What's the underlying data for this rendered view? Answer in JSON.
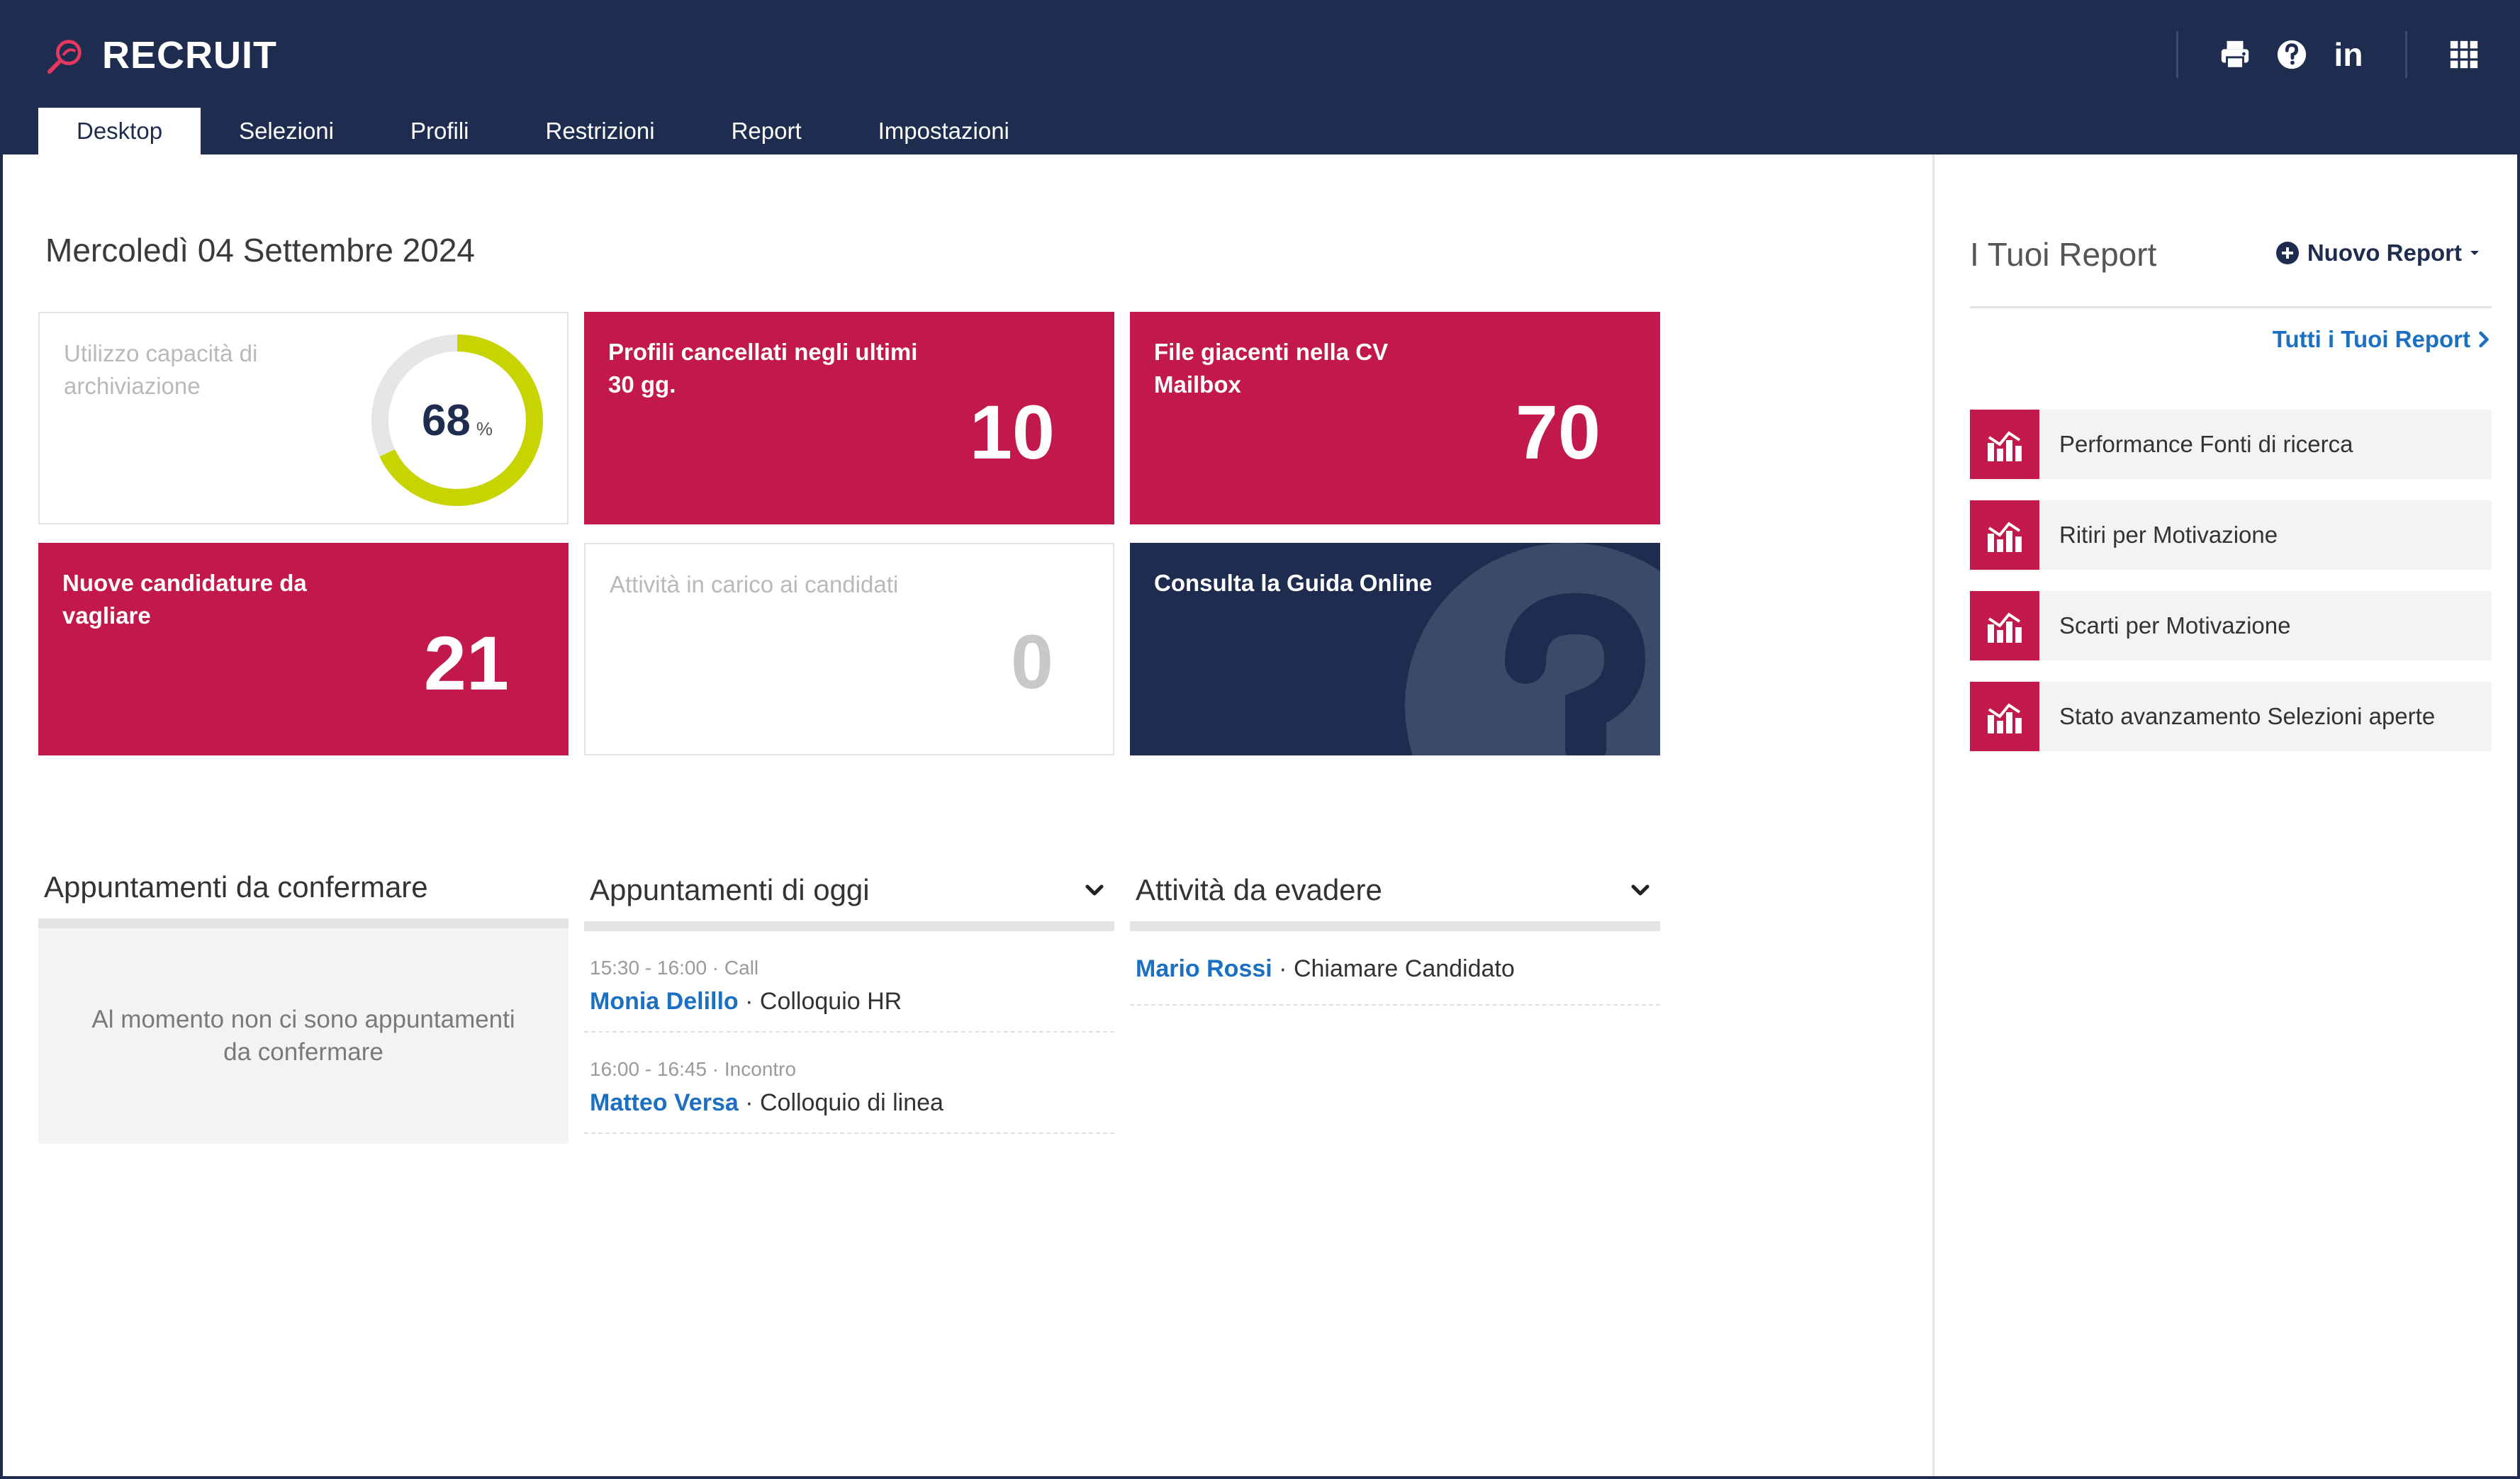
{
  "app": {
    "name": "RECRUIT"
  },
  "header": {
    "tools": {
      "linkedin": "in"
    },
    "tabs": [
      {
        "label": "Desktop",
        "active": true
      },
      {
        "label": "Selezioni"
      },
      {
        "label": "Profili"
      },
      {
        "label": "Restrizioni"
      },
      {
        "label": "Report"
      },
      {
        "label": "Impostazioni"
      }
    ]
  },
  "main": {
    "date": "Mercoledì 04 Settembre 2024",
    "tiles": {
      "storage": {
        "label": "Utilizzo capacità di archiviazione",
        "value": "68",
        "unit": "%",
        "percent": 68
      },
      "deleted": {
        "label": "Profili cancellati negli ultimi 30 gg.",
        "value": "10"
      },
      "mailbox": {
        "label": "File giacenti nella CV Mailbox",
        "value": "70"
      },
      "new_apps": {
        "label": "Nuove candidature da vagliare",
        "value": "21"
      },
      "tasks": {
        "label": "Attività in carico ai candidati",
        "value": "0"
      },
      "guide": {
        "label": "Consulta la Guida Online"
      }
    },
    "lists": {
      "to_confirm": {
        "title": "Appuntamenti da confermare",
        "empty": "Al momento non ci sono appuntamenti da confermare"
      },
      "today": {
        "title": "Appuntamenti di oggi",
        "items": [
          {
            "meta": "15:30 - 16:00 · Call",
            "person": "Monia Delillo",
            "sep": " · ",
            "desc": "Colloquio HR"
          },
          {
            "meta": "16:00 - 16:45 · Incontro",
            "person": "Matteo Versa",
            "sep": " · ",
            "desc": "Colloquio di linea"
          }
        ]
      },
      "todo": {
        "title": "Attività da evadere",
        "items": [
          {
            "person": "Mario Rossi",
            "sep": " · ",
            "desc": "Chiamare Candidato"
          }
        ]
      }
    }
  },
  "sidebar": {
    "title": "I Tuoi Report",
    "new_report": "Nuovo Report",
    "all_reports": "Tutti i Tuoi Report",
    "reports": [
      {
        "label": "Performance Fonti di ricerca"
      },
      {
        "label": "Ritiri per Motivazione"
      },
      {
        "label": "Scarti per Motivazione"
      },
      {
        "label": "Stato avanzamento Selezioni aperte"
      }
    ]
  },
  "colors": {
    "navy": "#1e2d4f",
    "red": "#c2184b",
    "link": "#1b70c2",
    "donut": "#c8d400"
  }
}
